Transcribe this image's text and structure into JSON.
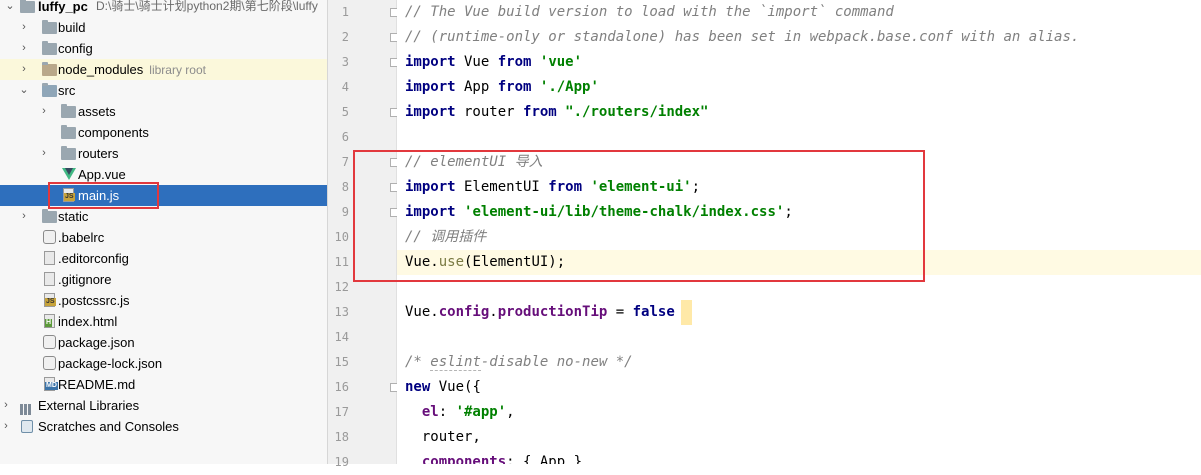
{
  "project_tree": {
    "root": {
      "name": "luffy_pc",
      "path": "D:\\骑士\\骑士计划python2期\\第七阶段\\luffy"
    },
    "items": [
      {
        "name": "build",
        "type": "folder"
      },
      {
        "name": "config",
        "type": "folder"
      },
      {
        "name": "node_modules",
        "type": "folder",
        "extra": "library root"
      },
      {
        "name": "src",
        "type": "folder"
      },
      {
        "name": "assets",
        "type": "folder"
      },
      {
        "name": "components",
        "type": "folder"
      },
      {
        "name": "routers",
        "type": "folder"
      },
      {
        "name": "App.vue",
        "type": "vue"
      },
      {
        "name": "main.js",
        "type": "js"
      },
      {
        "name": "static",
        "type": "folder"
      },
      {
        "name": ".babelrc",
        "type": "config"
      },
      {
        "name": ".editorconfig",
        "type": "text"
      },
      {
        "name": ".gitignore",
        "type": "text"
      },
      {
        "name": ".postcssrc.js",
        "type": "js"
      },
      {
        "name": "index.html",
        "type": "html"
      },
      {
        "name": "package.json",
        "type": "config"
      },
      {
        "name": "package-lock.json",
        "type": "config"
      },
      {
        "name": "README.md",
        "type": "md"
      },
      {
        "name": "External Libraries",
        "type": "library"
      },
      {
        "name": "Scratches and Consoles",
        "type": "scratch"
      }
    ],
    "icon_tags": {
      "js": "JS",
      "md": "MD",
      "html": "H"
    },
    "selected": "main.js"
  },
  "editor": {
    "line_numbers": [
      "1",
      "2",
      "3",
      "4",
      "5",
      "6",
      "7",
      "8",
      "9",
      "10",
      "11",
      "12",
      "13",
      "14",
      "15",
      "16",
      "17",
      "18",
      "19"
    ],
    "lines": {
      "l1": "// The Vue build version to load with the `import` command",
      "l2": "// (runtime-only or standalone) has been set in webpack.base.conf with an alias.",
      "l3": [
        "import",
        " Vue ",
        "from",
        " ",
        "'vue'"
      ],
      "l4": [
        "import",
        " App ",
        "from",
        " ",
        "'./App'"
      ],
      "l5": [
        "import",
        " router ",
        "from",
        " ",
        "\"./routers/index\""
      ],
      "l7": "// elementUI 导入",
      "l8": [
        "import",
        " ElementUI ",
        "from",
        " ",
        "'element-ui'",
        ";"
      ],
      "l9": [
        "import",
        " ",
        "'element-ui/lib/theme-chalk/index.css'",
        ";"
      ],
      "l10": "// 调用插件",
      "l11": [
        "Vue.",
        "use",
        "(ElementUI);"
      ],
      "l13": [
        "Vue.",
        "config",
        ".",
        "productionTip",
        " = ",
        "false"
      ],
      "l15": [
        "/* ",
        "eslint",
        "-disable no-new */"
      ],
      "l16": [
        "new",
        " Vue({"
      ],
      "l17": [
        "  ",
        "el",
        ": ",
        "'#app'",
        ","
      ],
      "l18": "  router,",
      "l19": [
        "  ",
        "components",
        ": { App }"
      ]
    }
  },
  "colors": {
    "selection": "#2e6fbd",
    "highlight_box": "#e2383d",
    "caret_line": "#fffae3",
    "keyword": "#000080",
    "string": "#008000",
    "comment": "#808080"
  }
}
